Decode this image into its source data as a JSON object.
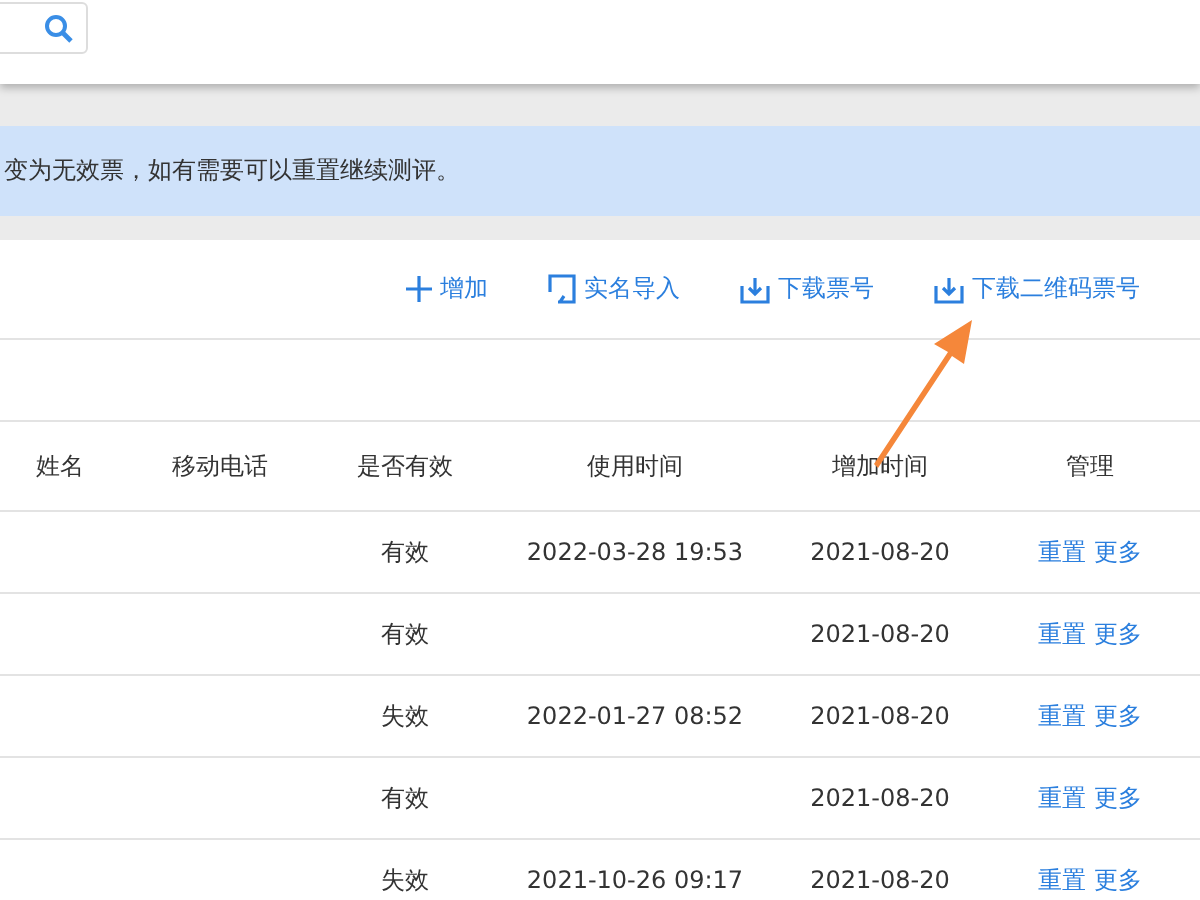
{
  "notice": "变为无效票，如有需要可以重置继续测评。",
  "toolbar": [
    {
      "kind": "add",
      "label": "增加"
    },
    {
      "kind": "import",
      "label": "实名导入"
    },
    {
      "kind": "download",
      "label": "下载票号"
    },
    {
      "kind": "download",
      "label": "下载二维码票号"
    }
  ],
  "table": {
    "columns": [
      "姓名",
      "移动电话",
      "是否有效",
      "使用时间",
      "增加时间",
      "管理"
    ],
    "rows": [
      {
        "status": "有效",
        "used": "2022-03-28 19:53",
        "added": "2021-08-20",
        "actions": [
          "重置",
          "更多"
        ]
      },
      {
        "status": "有效",
        "used": "",
        "added": "2021-08-20",
        "actions": [
          "重置",
          "更多"
        ]
      },
      {
        "status": "失效",
        "used": "2022-01-27 08:52",
        "added": "2021-08-20",
        "actions": [
          "重置",
          "更多"
        ]
      },
      {
        "status": "有效",
        "used": "",
        "added": "2021-08-20",
        "actions": [
          "重置",
          "更多"
        ]
      },
      {
        "status": "失效",
        "used": "2021-10-26 09:17",
        "added": "2021-08-20",
        "actions": [
          "重置",
          "更多"
        ]
      }
    ]
  }
}
